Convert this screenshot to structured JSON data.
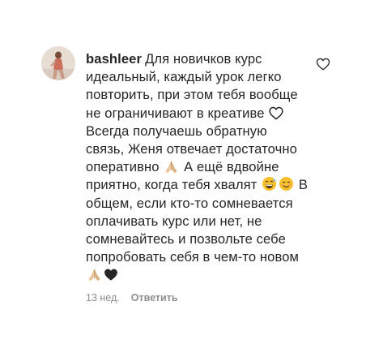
{
  "comment": {
    "username": "bashleer",
    "text_parts": [
      "Для новичков курс идеальный, каждый урок легко повторить, при этом тебя вообще не ограничивают в креативе",
      "Всегда получаешь обратную связь, Женя отвечает достаточно оперативно",
      "А ещё вдвойне приятно, когда тебя хвалят",
      "В общем, если кто-то сомневается оплачивать курс или нет, не сомневайтесь и позвольте себе попробовать себя в чем-то новом"
    ],
    "time": "13 нед.",
    "reply_label": "Ответить"
  },
  "icons": {
    "avatar": "user-avatar-photo",
    "like": "heart-outline-icon",
    "emoji_heart_outline": "white-heart-emoji",
    "emoji_pray": "folded-hands-emoji",
    "emoji_grin_sweat": "grinning-face-with-sweat-emoji",
    "emoji_smile": "smiling-face-emoji",
    "emoji_black_heart": "black-heart-emoji"
  },
  "colors": {
    "text": "#262626",
    "secondary": "#8e8e8e",
    "background": "#ffffff"
  }
}
